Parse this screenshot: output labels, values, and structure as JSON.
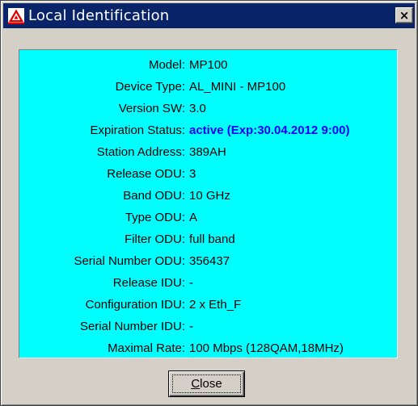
{
  "window": {
    "title": "Local Identification",
    "icon": "warning-triangle-logo-icon",
    "close_glyph": "×"
  },
  "colors": {
    "titlebar": "#0a246a",
    "panel": "#00ffff",
    "active_status": "#0000ff",
    "dialog": "#d4d0c8"
  },
  "fields": [
    {
      "label": "Model:",
      "value": "MP100"
    },
    {
      "label": "Device Type:",
      "value": "AL_MINI - MP100"
    },
    {
      "label": "Version SW:",
      "value": "3.0"
    },
    {
      "label": "Expiration Status:",
      "value": "active (Exp:30.04.2012 9:00)",
      "emphasis": true
    },
    {
      "label": "Station Address:",
      "value": "389AH"
    },
    {
      "label": "Release ODU:",
      "value": "3"
    },
    {
      "label": "Band ODU:",
      "value": "10 GHz"
    },
    {
      "label": "Type ODU:",
      "value": "A"
    },
    {
      "label": "Filter ODU:",
      "value": "full band"
    },
    {
      "label": "Serial Number ODU:",
      "value": "356437"
    },
    {
      "label": "Release IDU:",
      "value": "-"
    },
    {
      "label": "Configuration IDU:",
      "value": "2 x Eth_F"
    },
    {
      "label": "Serial Number IDU:",
      "value": "-"
    },
    {
      "label": "Maximal Rate:",
      "value": "100 Mbps (128QAM,18MHz)"
    }
  ],
  "buttons": {
    "close_label": "Close"
  }
}
